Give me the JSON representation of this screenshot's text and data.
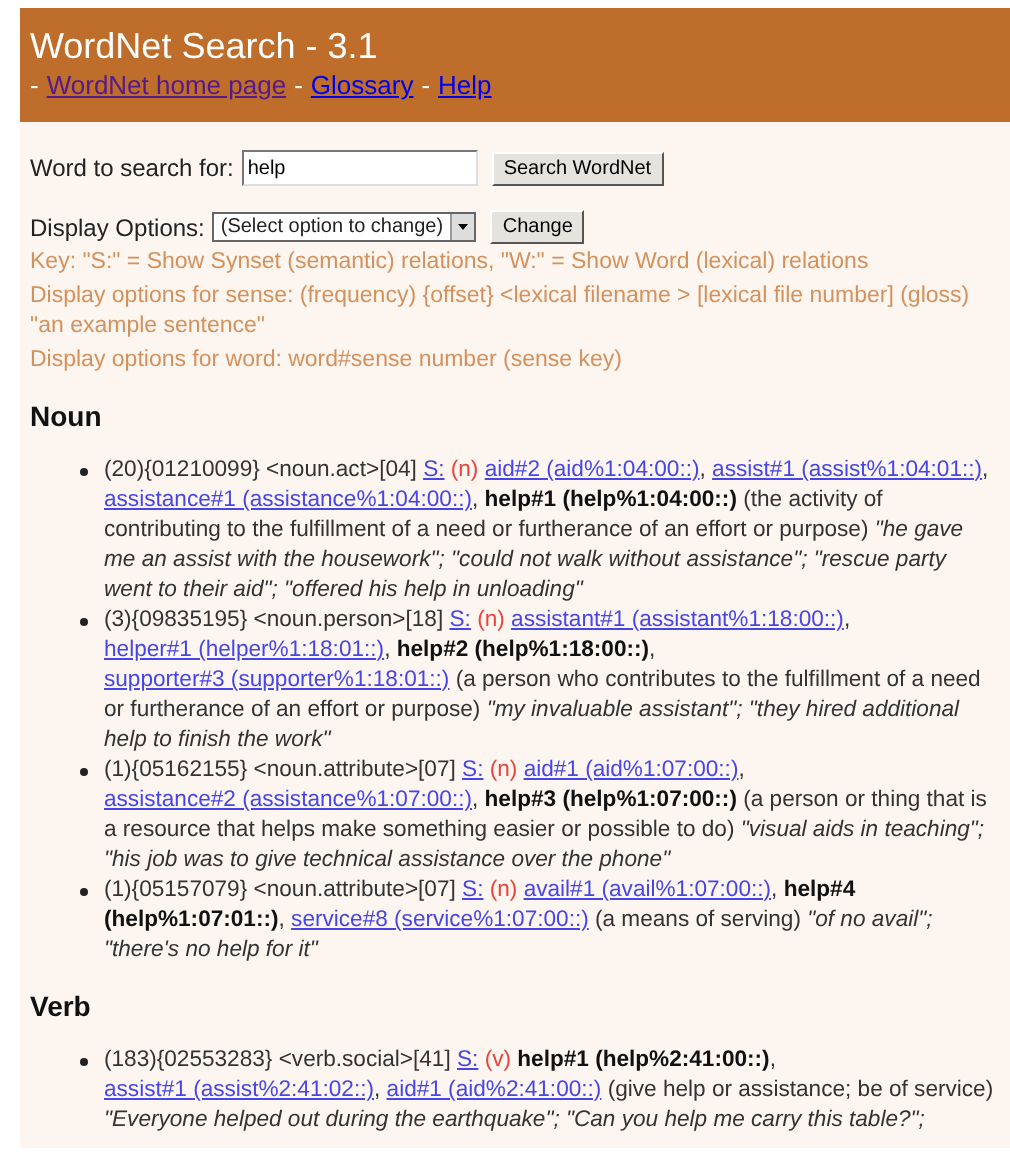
{
  "header": {
    "title": "WordNet Search - 3.1",
    "separator": "-",
    "links": [
      {
        "text": "WordNet home page",
        "visited": true
      },
      {
        "text": "Glossary",
        "visited": false
      },
      {
        "text": "Help",
        "visited": false
      }
    ]
  },
  "search": {
    "label": "Word to search for:",
    "value": "help",
    "button": "Search WordNet"
  },
  "display_options": {
    "label": "Display Options:",
    "select": "(Select option to change)",
    "button": "Change"
  },
  "notes": [
    "Key: \"S:\" = Show Synset (semantic) relations, \"W:\" = Show Word (lexical) relations",
    "Display options for sense: (frequency) {offset} <lexical filename > [lexical file number] (gloss) \"an example sentence\"",
    "Display options for word: word#sense number (sense key)"
  ],
  "sections": [
    {
      "heading": "Noun",
      "senses": [
        {
          "parts": [
            {
              "kind": "text",
              "text": "(20){01210099} <noun.act>[04] "
            },
            {
              "kind": "link",
              "text": "S:"
            },
            {
              "kind": "pos",
              "text": " (n) "
            },
            {
              "kind": "link",
              "text": "aid#2 (aid%1:04:00::)"
            },
            {
              "kind": "text",
              "text": ", "
            },
            {
              "kind": "link",
              "text": "assist#1 (assist%1:04:01::)"
            },
            {
              "kind": "text",
              "text": ", "
            },
            {
              "kind": "link",
              "text": "assistance#1 (assistance%1:04:00::)"
            },
            {
              "kind": "text",
              "text": ", "
            },
            {
              "kind": "bold",
              "text": "help#1 (help%1:04:00::)"
            },
            {
              "kind": "text",
              "text": " (the activity of contributing to the fulfillment of a need or furtherance of an effort or purpose) "
            },
            {
              "kind": "italic",
              "text": "\"he gave me an assist with the housework\"; \"could not walk without assistance\"; \"rescue party went to their aid\"; \"offered his help in unloading\""
            }
          ]
        },
        {
          "parts": [
            {
              "kind": "text",
              "text": "(3){09835195} <noun.person>[18] "
            },
            {
              "kind": "link",
              "text": "S:"
            },
            {
              "kind": "pos",
              "text": " (n) "
            },
            {
              "kind": "link",
              "text": "assistant#1 (assistant%1:18:00::)"
            },
            {
              "kind": "text",
              "text": ", "
            },
            {
              "kind": "link",
              "text": "helper#1 (helper%1:18:01::)"
            },
            {
              "kind": "text",
              "text": ", "
            },
            {
              "kind": "bold",
              "text": "help#2 (help%1:18:00::)"
            },
            {
              "kind": "text",
              "text": ", "
            },
            {
              "kind": "link",
              "text": "supporter#3 (supporter%1:18:01::)"
            },
            {
              "kind": "text",
              "text": " (a person who contributes to the fulfillment of a need or furtherance of an effort or purpose) "
            },
            {
              "kind": "italic",
              "text": "\"my invaluable assistant\"; \"they hired additional help to finish the work\""
            }
          ]
        },
        {
          "parts": [
            {
              "kind": "text",
              "text": "(1){05162155} <noun.attribute>[07] "
            },
            {
              "kind": "link",
              "text": "S:"
            },
            {
              "kind": "pos",
              "text": " (n) "
            },
            {
              "kind": "link",
              "text": "aid#1 (aid%1:07:00::)"
            },
            {
              "kind": "text",
              "text": ", "
            },
            {
              "kind": "link",
              "text": "assistance#2 (assistance%1:07:00::)"
            },
            {
              "kind": "text",
              "text": ", "
            },
            {
              "kind": "bold",
              "text": "help#3 (help%1:07:00::)"
            },
            {
              "kind": "text",
              "text": " (a person or thing that is a resource that helps make something easier or possible to do) "
            },
            {
              "kind": "italic",
              "text": "\"visual aids in teaching\"; \"his job was to give technical assistance over the phone\""
            }
          ]
        },
        {
          "parts": [
            {
              "kind": "text",
              "text": "(1){05157079} <noun.attribute>[07] "
            },
            {
              "kind": "link",
              "text": "S:"
            },
            {
              "kind": "pos",
              "text": " (n) "
            },
            {
              "kind": "link",
              "text": "avail#1 (avail%1:07:00::)"
            },
            {
              "kind": "text",
              "text": ", "
            },
            {
              "kind": "bold",
              "text": "help#4 (help%1:07:01::)"
            },
            {
              "kind": "text",
              "text": ", "
            },
            {
              "kind": "link",
              "text": "service#8 (service%1:07:00::)"
            },
            {
              "kind": "text",
              "text": " (a means of serving) "
            },
            {
              "kind": "italic",
              "text": "\"of no avail\"; \"there's no help for it\""
            }
          ]
        }
      ]
    },
    {
      "heading": "Verb",
      "senses": [
        {
          "parts": [
            {
              "kind": "text",
              "text": "(183){02553283} <verb.social>[41] "
            },
            {
              "kind": "link",
              "text": "S:"
            },
            {
              "kind": "pos",
              "text": " (v) "
            },
            {
              "kind": "bold",
              "text": "help#1 (help%2:41:00::)"
            },
            {
              "kind": "text",
              "text": ", "
            },
            {
              "kind": "link",
              "text": "assist#1 (assist%2:41:02::)"
            },
            {
              "kind": "text",
              "text": ", "
            },
            {
              "kind": "link",
              "text": "aid#1 (aid%2:41:00::)"
            },
            {
              "kind": "text",
              "text": " (give help or assistance; be of service) "
            },
            {
              "kind": "italic",
              "text": "\"Everyone helped out during the earthquake\"; \"Can you help me carry this table?\";"
            }
          ]
        }
      ]
    }
  ]
}
